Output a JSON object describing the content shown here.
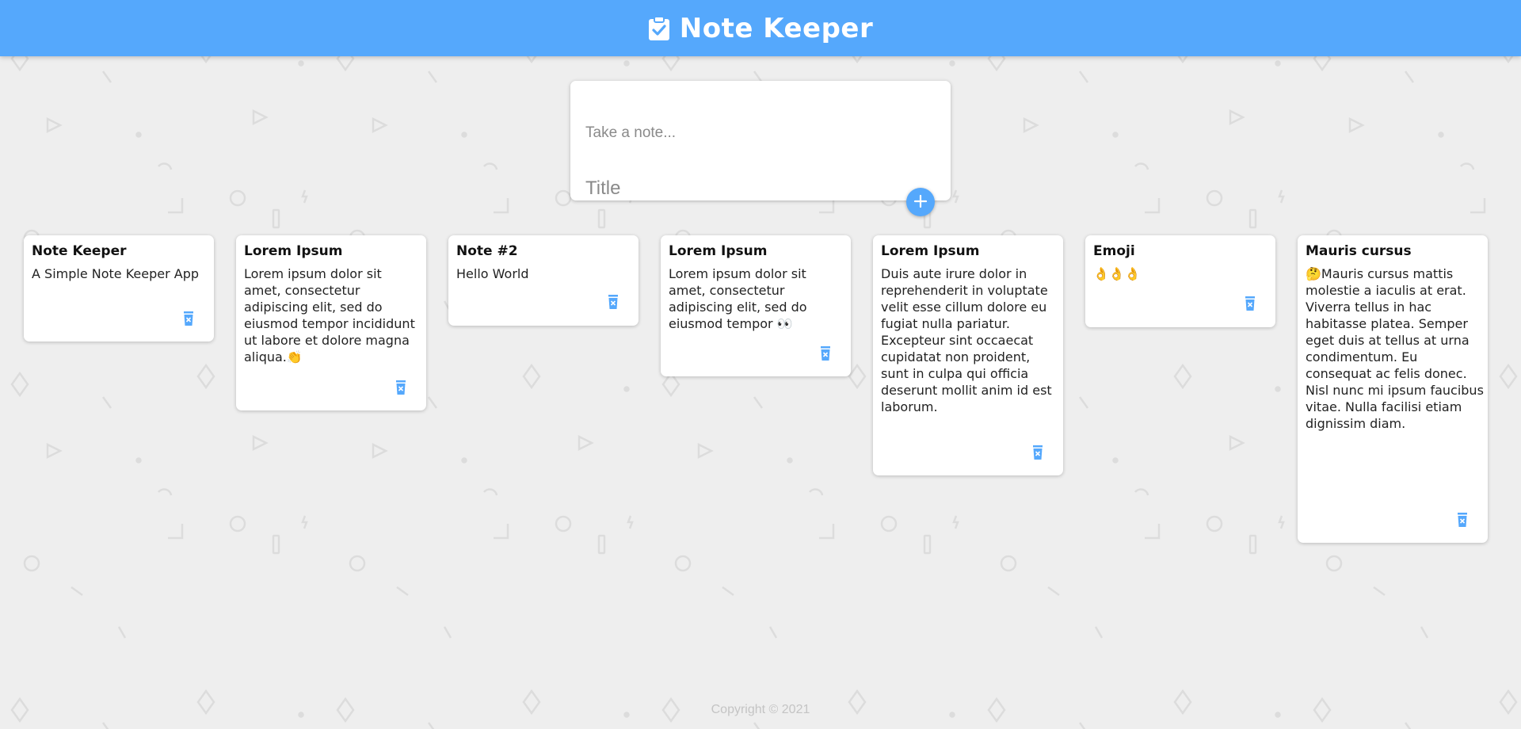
{
  "app": {
    "title": "Note Keeper",
    "accent_color": "#55a8fc",
    "logo_icon": "clipboard-check-icon"
  },
  "composer": {
    "title_placeholder": "Title",
    "content_placeholder": "Take a note...",
    "add_icon": "plus-icon"
  },
  "notes": [
    {
      "title": "Note Keeper",
      "content": "A Simple Note Keeper App"
    },
    {
      "title": "Lorem Ipsum",
      "content": "Lorem ipsum dolor sit amet, consectetur adipiscing elit, sed do eiusmod tempor incididunt ut labore et dolore magna aliqua.👏"
    },
    {
      "title": "Note #2",
      "content": "Hello World"
    },
    {
      "title": "Lorem Ipsum",
      "content": "Lorem ipsum dolor sit amet, consectetur adipiscing elit, sed do eiusmod tempor 👀"
    },
    {
      "title": "Lorem Ipsum",
      "content": "Duis aute irure dolor in reprehenderit in voluptate velit esse cillum dolore eu fugiat nulla pariatur. Excepteur sint occaecat cupidatat non proident, sunt in culpa qui officia deserunt mollit anim id est laborum."
    },
    {
      "title": "Emoji",
      "content": "👌👌👌"
    },
    {
      "title": "Mauris cursus",
      "content": "🤔Mauris cursus mattis molestie a iaculis at erat. Viverra tellus in hac habitasse platea. Semper eget duis at tellus at urna condimentum. Eu consequat ac felis donec. Nisl nunc mi ipsum faucibus vitae. Nulla facilisi etiam dignissim diam."
    }
  ],
  "note_delete_icon": "trash-delete-icon",
  "footer": {
    "copyright": "Copyright © 2021"
  }
}
